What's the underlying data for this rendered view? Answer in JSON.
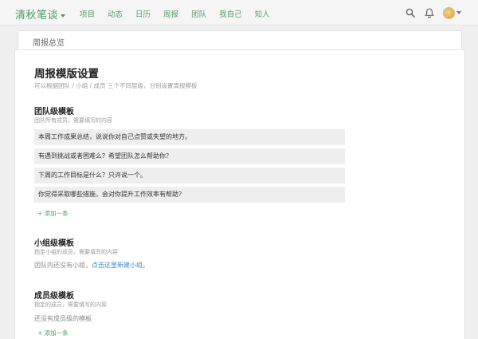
{
  "header": {
    "brand": "清秋笔谈",
    "nav": [
      "项目",
      "动态",
      "日历",
      "周报",
      "团队",
      "我自己",
      "知人"
    ],
    "icons": [
      "search-icon",
      "bell-icon",
      "avatar"
    ]
  },
  "breadcrumb": "周报总览",
  "main": {
    "title": "周报模版设置",
    "description": "可以根据团队 / 小组 / 成员 三个不同层级，分别设置周报模板",
    "team": {
      "title": "团队级模板",
      "desc": "团队所有成员，需要填写的内容",
      "items": [
        "本周工作成果总结，说说你对自己点赞或失望的地方。",
        "有遇到挑战或者困难么？希望团队怎么帮助你？",
        "下周的工作目标是什么？只许说一个。",
        "你觉得采取哪些措施，会对你提升工作效率有帮助？"
      ],
      "add": "+ 添加一条"
    },
    "group": {
      "title": "小组级模板",
      "desc": "指定小组的成员，需要填写的内容",
      "note_prefix": "团队内还没有小组，",
      "note_link": "点击这里新建小组",
      "note_suffix": "。"
    },
    "member": {
      "title": "成员级模板",
      "desc": "指定的成员，需要填写的内容",
      "note": "还没有成员级的模板",
      "add": "+ 添加一条"
    }
  },
  "colors": {
    "brand": "#4a9a64",
    "link": "#3a8fc0",
    "item_bg": "#eeeeee"
  }
}
